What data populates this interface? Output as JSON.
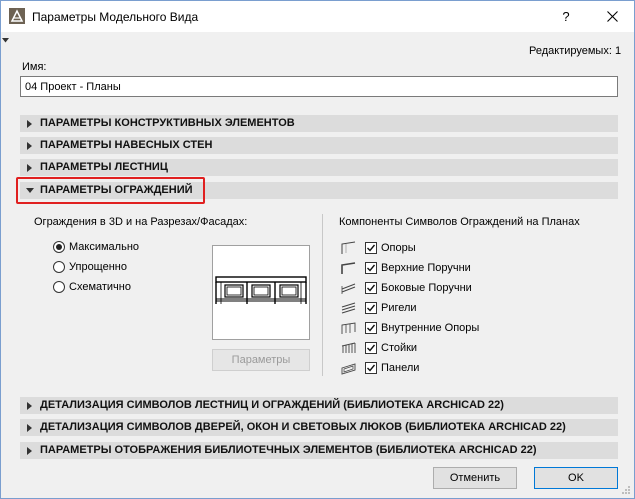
{
  "window": {
    "title": "Параметры Модельного Вида",
    "help_label": "?",
    "close_label": "✕"
  },
  "editable_count_label": "Редактируемых: 1",
  "name_label": "Имя:",
  "name_value": "04 Проект - Планы",
  "sections_top": [
    {
      "label": "ПАРАМЕТРЫ КОНСТРУКТИВНЫХ ЭЛЕМЕНТОВ",
      "expanded": false
    },
    {
      "label": "ПАРАМЕТРЫ НАВЕСНЫХ СТЕН",
      "expanded": false
    },
    {
      "label": "ПАРАМЕТРЫ ЛЕСТНИЦ",
      "expanded": false
    },
    {
      "label": "ПАРАМЕТРЫ ОГРАЖДЕНИЙ",
      "expanded": true,
      "highlight_color": "#e02020"
    }
  ],
  "railings_panel": {
    "left_title": "Ограждения в 3D и на Разрезах/Фасадах:",
    "radios": [
      {
        "label": "Максимально",
        "selected": true
      },
      {
        "label": "Упрощенно",
        "selected": false
      },
      {
        "label": "Схематично",
        "selected": false
      }
    ],
    "params_button": "Параметры",
    "right_title": "Компоненты Символов Ограждений на Планах",
    "components": [
      {
        "label": "Опоры",
        "checked": true,
        "icon": "posts-symbol-icon"
      },
      {
        "label": "Верхние Поручни",
        "checked": true,
        "icon": "top-rail-symbol-icon"
      },
      {
        "label": "Боковые Поручни",
        "checked": true,
        "icon": "handrail-symbol-icon"
      },
      {
        "label": "Ригели",
        "checked": true,
        "icon": "rail-symbol-icon"
      },
      {
        "label": "Внутренние Опоры",
        "checked": true,
        "icon": "inner-posts-symbol-icon"
      },
      {
        "label": "Стойки",
        "checked": true,
        "icon": "balusters-symbol-icon"
      },
      {
        "label": "Панели",
        "checked": true,
        "icon": "panels-symbol-icon"
      }
    ]
  },
  "sections_bottom": [
    {
      "label": "ДЕТАЛИЗАЦИЯ СИМВОЛОВ ЛЕСТНИЦ И ОГРАЖДЕНИЙ (БИБЛИОТЕКА ARCHICAD 22)",
      "expanded": false
    },
    {
      "label": "ДЕТАЛИЗАЦИЯ СИМВОЛОВ ДВЕРЕЙ, ОКОН И СВЕТОВЫХ ЛЮКОВ (БИБЛИОТЕКА ARCHICAD 22)",
      "expanded": false
    },
    {
      "label": "ПАРАМЕТРЫ ОТОБРАЖЕНИЯ БИБЛИОТЕЧНЫХ ЭЛЕМЕНТОВ (БИБЛИОТЕКА ARCHICAD 22)",
      "expanded": false
    }
  ],
  "buttons": {
    "cancel": "Отменить",
    "ok": "OK"
  }
}
